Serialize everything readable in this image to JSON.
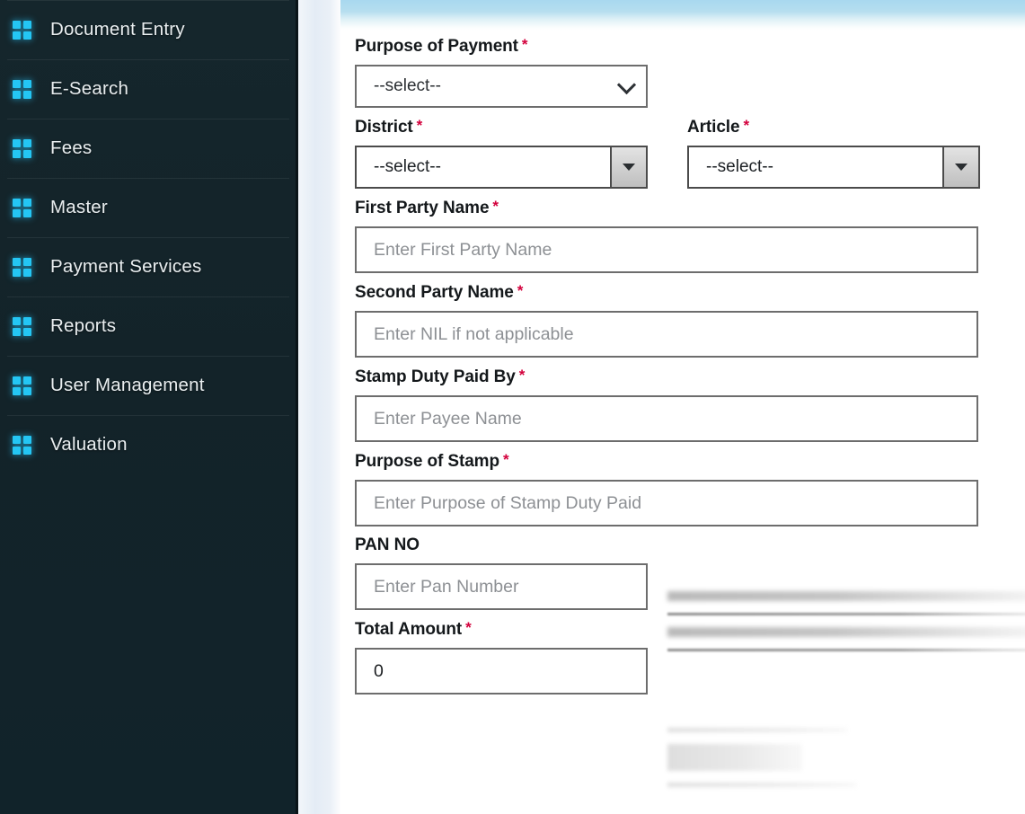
{
  "sidebar": {
    "icon_name": "grid-icon",
    "accent_color": "#24c6f4",
    "background_color": "#132329",
    "items": [
      {
        "label": "Document Entry"
      },
      {
        "label": "E-Search"
      },
      {
        "label": "Fees"
      },
      {
        "label": "Master"
      },
      {
        "label": "Payment Services"
      },
      {
        "label": "Reports"
      },
      {
        "label": "User Management"
      },
      {
        "label": "Valuation"
      }
    ]
  },
  "content": {
    "top_band_color": "#b6deef",
    "required_marker": "*",
    "required_color": "#d3003c"
  },
  "form": {
    "purpose_of_payment": {
      "label": "Purpose of Payment",
      "value": "--select--",
      "control": "select"
    },
    "district": {
      "label": "District",
      "value": "--select--",
      "control": "select"
    },
    "article": {
      "label": "Article",
      "value": "--select--",
      "control": "select"
    },
    "first_party_name": {
      "label": "First Party Name",
      "placeholder": "Enter First Party Name",
      "value": ""
    },
    "second_party_name": {
      "label": "Second Party Name",
      "placeholder": "Enter NIL if not applicable",
      "value": ""
    },
    "stamp_duty_paid_by": {
      "label": "Stamp Duty Paid By",
      "placeholder": "Enter Payee Name",
      "value": ""
    },
    "purpose_of_stamp": {
      "label": "Purpose of Stamp",
      "placeholder": "Enter Purpose of Stamp Duty Paid",
      "value": ""
    },
    "pan_no": {
      "label": "PAN NO",
      "placeholder": "Enter Pan Number",
      "value": ""
    },
    "total_amount": {
      "label": "Total Amount",
      "value": "0"
    }
  }
}
